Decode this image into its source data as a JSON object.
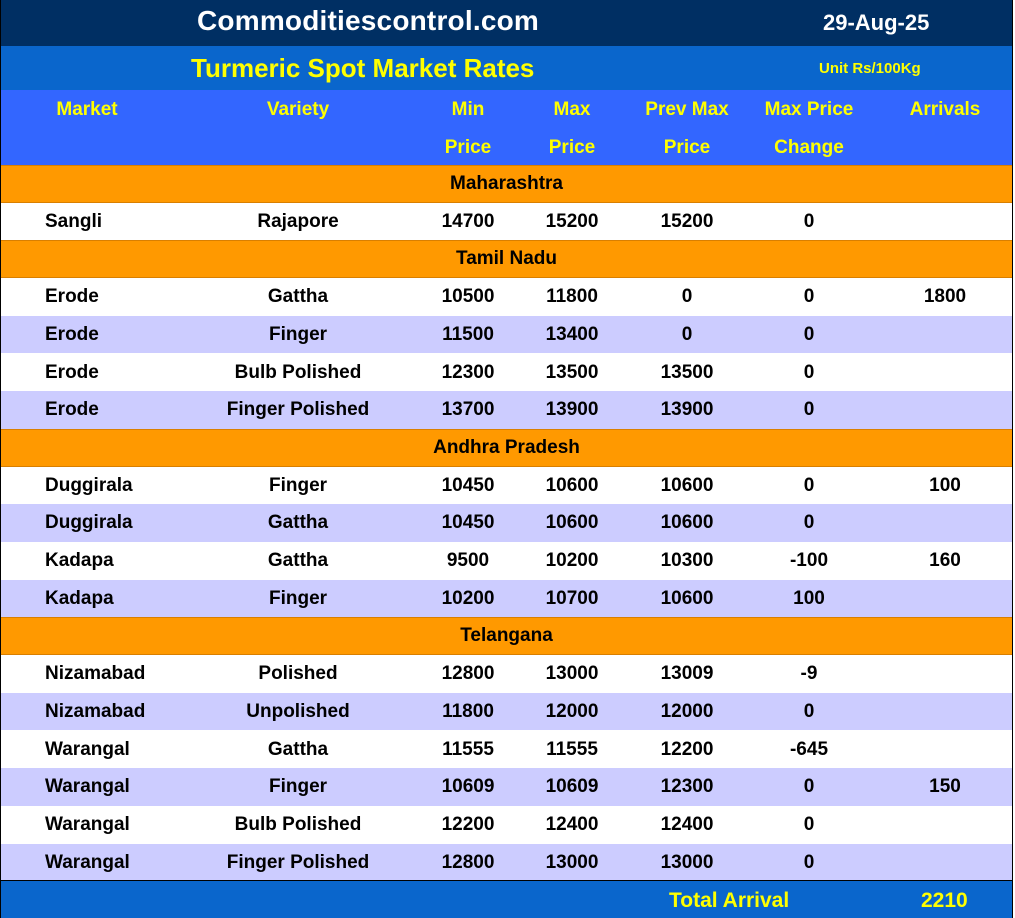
{
  "header": {
    "site": "Commoditiescontrol.com",
    "date": "29-Aug-25",
    "title": "Turmeric Spot Market Rates",
    "unit": "Unit Rs/100Kg"
  },
  "columns": {
    "market": [
      "Market",
      ""
    ],
    "variety": [
      "Variety",
      ""
    ],
    "min": [
      "Min",
      "Price"
    ],
    "max": [
      "Max",
      "Price"
    ],
    "prev": [
      "Prev Max",
      "Price"
    ],
    "change": [
      "Max Price",
      "Change"
    ],
    "arrivals": [
      "Arrivals",
      ""
    ]
  },
  "rows": [
    {
      "type": "region",
      "name": "Maharashtra"
    },
    {
      "type": "data",
      "market": "Sangli",
      "variety": "Rajapore",
      "min": "14700",
      "max": "15200",
      "prev": "15200",
      "change": "0",
      "arrivals": ""
    },
    {
      "type": "region",
      "name": "Tamil Nadu"
    },
    {
      "type": "data",
      "market": "Erode",
      "variety": "Gattha",
      "min": "10500",
      "max": "11800",
      "prev": "0",
      "change": "0",
      "arrivals": "1800"
    },
    {
      "type": "data",
      "market": "Erode",
      "variety": "Finger",
      "min": "11500",
      "max": "13400",
      "prev": "0",
      "change": "0",
      "arrivals": ""
    },
    {
      "type": "data",
      "market": "Erode",
      "variety": "Bulb Polished",
      "min": "12300",
      "max": "13500",
      "prev": "13500",
      "change": "0",
      "arrivals": ""
    },
    {
      "type": "data",
      "market": "Erode",
      "variety": "Finger Polished",
      "min": "13700",
      "max": "13900",
      "prev": "13900",
      "change": "0",
      "arrivals": ""
    },
    {
      "type": "region",
      "name": "Andhra Pradesh"
    },
    {
      "type": "data",
      "market": "Duggirala",
      "variety": "Finger",
      "min": "10450",
      "max": "10600",
      "prev": "10600",
      "change": "0",
      "arrivals": "100"
    },
    {
      "type": "data",
      "market": "Duggirala",
      "variety": "Gattha",
      "min": "10450",
      "max": "10600",
      "prev": "10600",
      "change": "0",
      "arrivals": ""
    },
    {
      "type": "data",
      "market": "Kadapa",
      "variety": "Gattha",
      "min": "9500",
      "max": "10200",
      "prev": "10300",
      "change": "-100",
      "arrivals": "160"
    },
    {
      "type": "data",
      "market": "Kadapa",
      "variety": "Finger",
      "min": "10200",
      "max": "10700",
      "prev": "10600",
      "change": "100",
      "arrivals": ""
    },
    {
      "type": "region",
      "name": "Telangana"
    },
    {
      "type": "data",
      "market": "Nizamabad",
      "variety": "Polished",
      "min": "12800",
      "max": "13000",
      "prev": "13009",
      "change": "-9",
      "arrivals": ""
    },
    {
      "type": "data",
      "market": "Nizamabad",
      "variety": "Unpolished",
      "min": "11800",
      "max": "12000",
      "prev": "12000",
      "change": "0",
      "arrivals": ""
    },
    {
      "type": "data",
      "market": "Warangal",
      "variety": "Gattha",
      "min": "11555",
      "max": "11555",
      "prev": "12200",
      "change": "-645",
      "arrivals": ""
    },
    {
      "type": "data",
      "market": "Warangal",
      "variety": "Finger",
      "min": "10609",
      "max": "10609",
      "prev": "12300",
      "change": "0",
      "arrivals": "150"
    },
    {
      "type": "data",
      "market": "Warangal",
      "variety": "Bulb Polished",
      "min": "12200",
      "max": "12400",
      "prev": "12400",
      "change": "0",
      "arrivals": ""
    },
    {
      "type": "data",
      "market": "Warangal",
      "variety": "Finger Polished",
      "min": "12800",
      "max": "13000",
      "prev": "13000",
      "change": "0",
      "arrivals": ""
    }
  ],
  "footer": {
    "label": "Total Arrival",
    "value": "2210"
  },
  "colors": {
    "top_bar": "#002f63",
    "title_bar": "#0a66cc",
    "header_bar": "#3366ff",
    "header_text": "#ffff00",
    "region_row": "#ff9900",
    "row_white": "#ffffff",
    "row_lavender": "#ccccff"
  }
}
